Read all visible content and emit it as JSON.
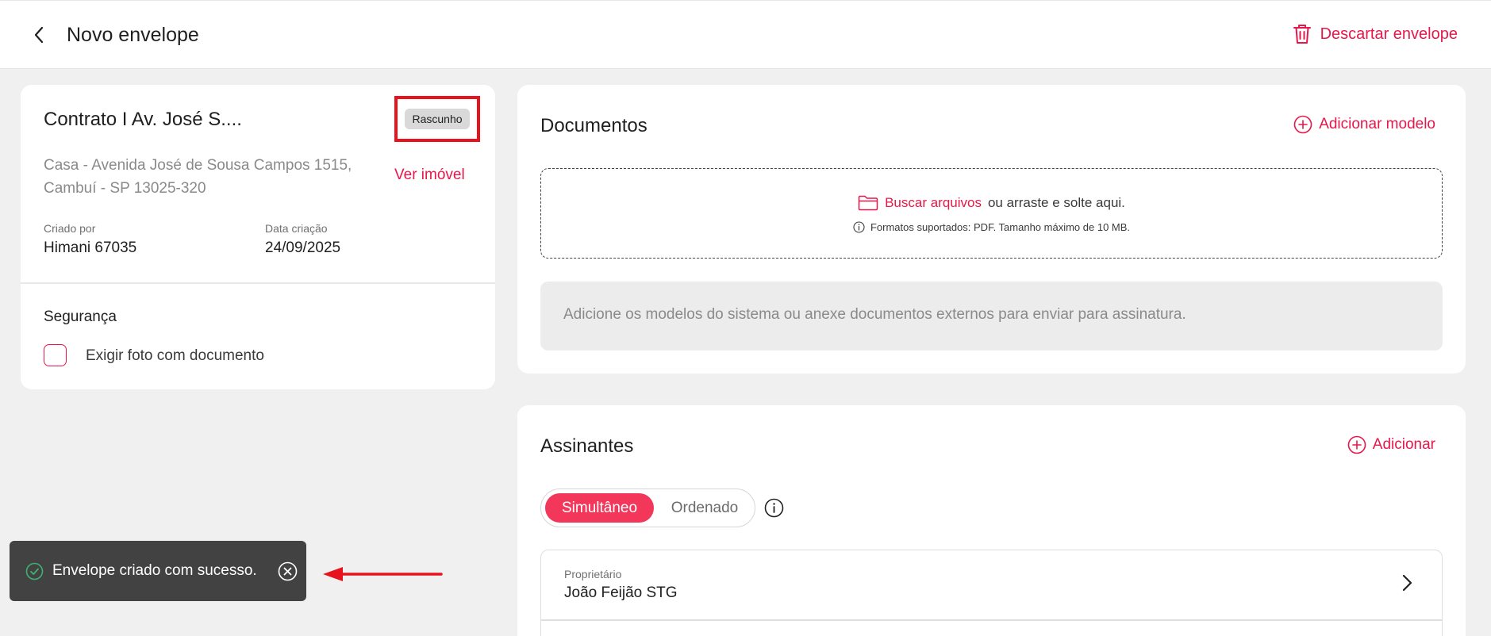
{
  "header": {
    "title": "Novo envelope",
    "discard_label": "Descartar envelope"
  },
  "envelope": {
    "title": "Contrato I Av. José S....",
    "status": "Rascunho",
    "address_line1": "Casa - Avenida José de Sousa Campos 1515,",
    "address_line2": "Cambuí - SP 13025-320",
    "view_property_label": "Ver imóvel",
    "created_by_label": "Criado por",
    "created_by_value": "Himani 67035",
    "created_date_label": "Data criação",
    "created_date_value": "24/09/2025",
    "security_title": "Segurança",
    "require_photo_label": "Exigir foto com documento",
    "require_photo_checked": false
  },
  "documents": {
    "title": "Documentos",
    "add_model_label": "Adicionar modelo",
    "browse_label": "Buscar arquivos",
    "drop_label": "ou arraste e solte aqui.",
    "formats_label": "Formatos suportados: PDF. Tamanho máximo de 10 MB.",
    "empty_message": "Adicione os modelos do sistema ou anexe documentos externos para enviar para assinatura."
  },
  "signers": {
    "title": "Assinantes",
    "add_label": "Adicionar",
    "mode_options": [
      "Simultâneo",
      "Ordenado"
    ],
    "mode_selected": "Simultâneo",
    "owner_label": "Proprietário",
    "owner_name": "João Feijão STG"
  },
  "toast": {
    "message": "Envelope criado com sucesso."
  },
  "colors": {
    "accent": "#e8174a",
    "toggle_active": "#f2375a",
    "toast_bg": "#424242",
    "annotation_red": "#e8121c",
    "success_green": "#3bb273"
  },
  "icons": [
    "chevron-left-icon",
    "trash-icon",
    "plus-circle-icon",
    "folder-icon",
    "info-circle-icon",
    "chevron-right-icon",
    "check-circle-icon",
    "close-circle-icon"
  ]
}
